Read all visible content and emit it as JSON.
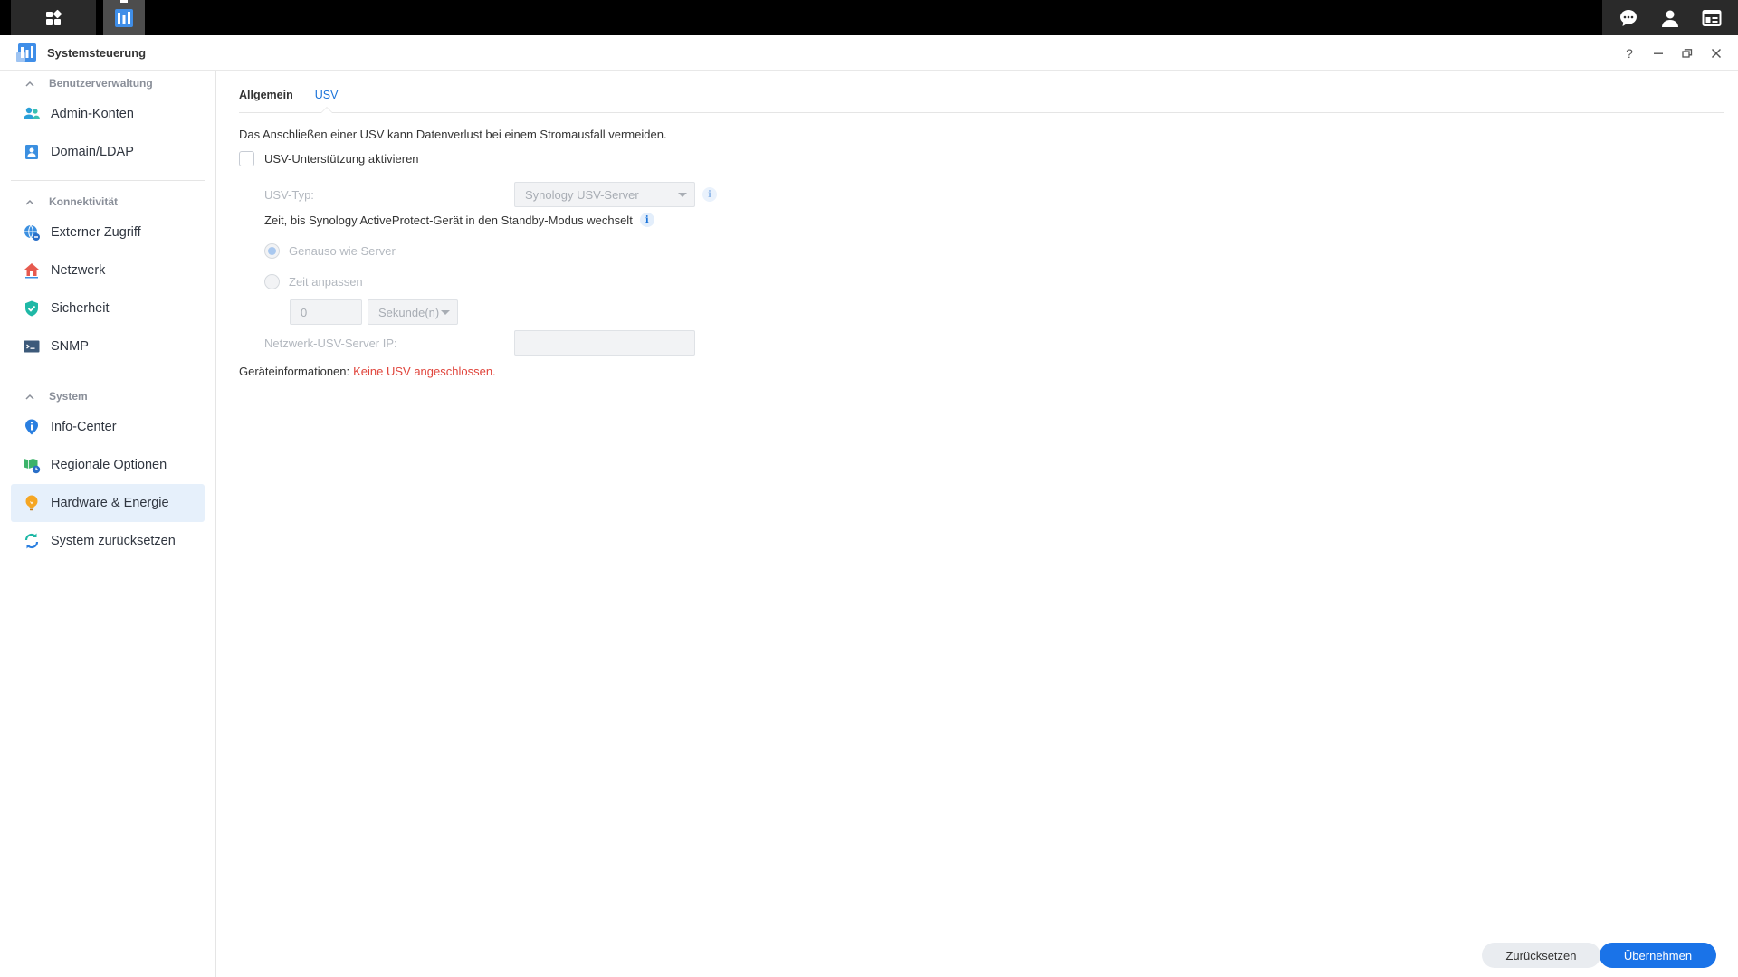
{
  "window": {
    "title": "Systemsteuerung",
    "help_label": "?"
  },
  "sidebar": {
    "groups": [
      {
        "label": "Benutzerverwaltung",
        "items": [
          {
            "label": "Admin-Konten",
            "icon": "users-icon"
          },
          {
            "label": "Domain/LDAP",
            "icon": "id-card-icon"
          }
        ]
      },
      {
        "label": "Konnektivität",
        "items": [
          {
            "label": "Externer Zugriff",
            "icon": "globe-link-icon"
          },
          {
            "label": "Netzwerk",
            "icon": "house-network-icon"
          },
          {
            "label": "Sicherheit",
            "icon": "shield-check-icon"
          },
          {
            "label": "SNMP",
            "icon": "terminal-icon"
          }
        ]
      },
      {
        "label": "System",
        "items": [
          {
            "label": "Info-Center",
            "icon": "info-pin-icon"
          },
          {
            "label": "Regionale Optionen",
            "icon": "map-clock-icon"
          },
          {
            "label": "Hardware & Energie",
            "icon": "bulb-icon",
            "active": true
          },
          {
            "label": "System zurücksetzen",
            "icon": "reset-arrows-icon"
          }
        ]
      }
    ]
  },
  "tabs": [
    {
      "label": "Allgemein",
      "active": false
    },
    {
      "label": "USV",
      "active": true
    }
  ],
  "usv": {
    "description": "Das Anschließen einer USV kann Datenverlust bei einem Stromausfall vermeiden.",
    "enable_label": "USV-Unterstützung aktivieren",
    "type_label": "USV-Typ:",
    "type_value": "Synology USV-Server",
    "standby_label": "Zeit, bis Synology ActiveProtect-Gerät in den Standby-Modus wechselt",
    "radio_same": "Genauso wie Server",
    "radio_custom": "Zeit anpassen",
    "time_value": "0",
    "time_unit": "Sekunde(n)",
    "server_ip_label": "Netzwerk-USV-Server IP:",
    "server_ip_value": "",
    "device_info_label": "Geräteinformationen:",
    "device_info_value": "Keine USV angeschlossen."
  },
  "footer": {
    "reset_label": "Zurücksetzen",
    "apply_label": "Übernehmen"
  },
  "colors": {
    "accent": "#1a73e8",
    "error": "#e0453c",
    "active_bg": "#e6f0fb"
  }
}
